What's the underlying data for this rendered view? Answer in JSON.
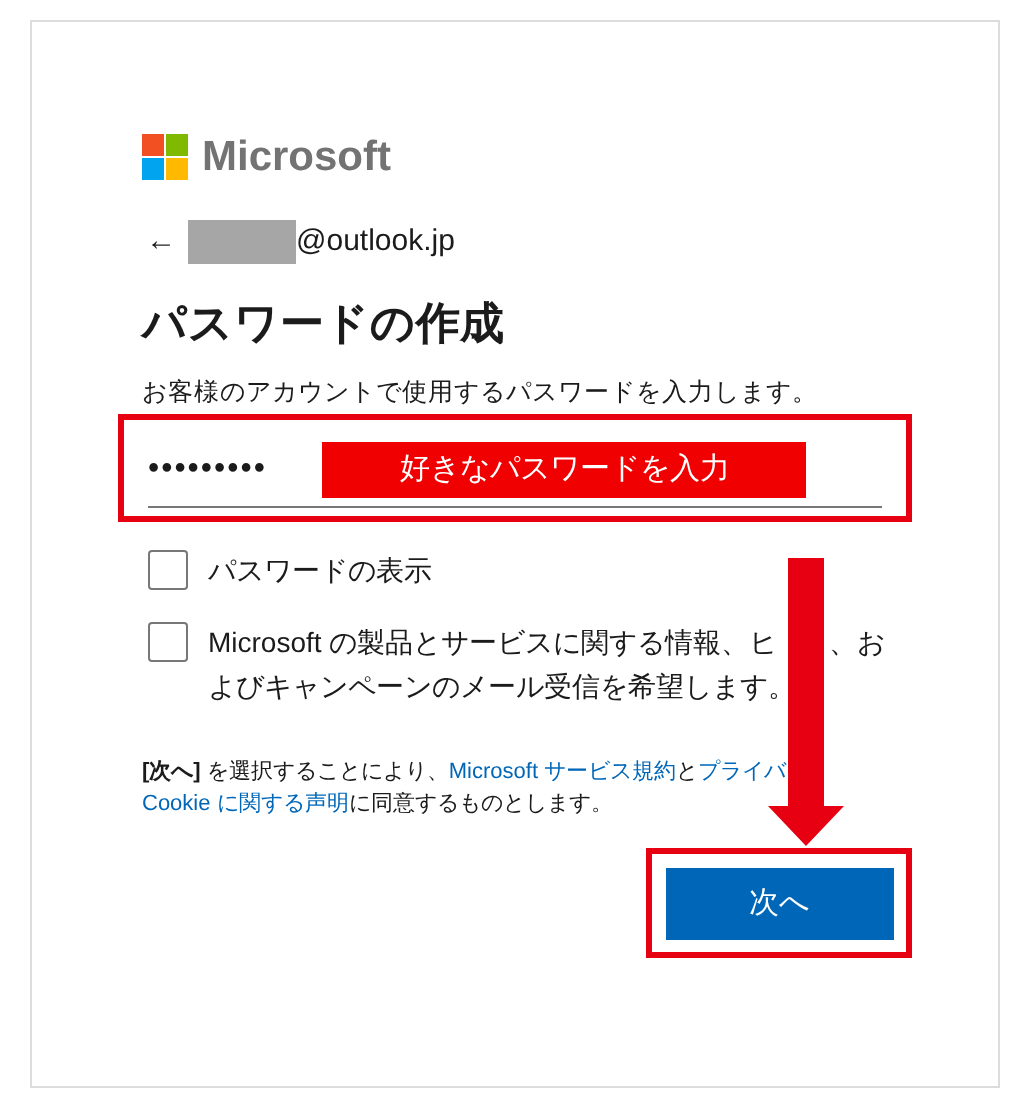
{
  "logo": {
    "name": "Microsoft"
  },
  "account": {
    "back": "←",
    "email": "@outlook.jp",
    "redacted": true
  },
  "title": "パスワードの作成",
  "instruction": "お客様のアカウントで使用するパスワードを入力します。",
  "password": {
    "value": "•••••••••",
    "annotation": "好きなパスワードを入力"
  },
  "checkboxes": [
    {
      "lines": [
        [
          "パスワードの表示"
        ]
      ],
      "checked": false
    },
    {
      "lines": [
        [
          "Microsoft の製品とサービスに関する情報、ヒ",
          "、お"
        ],
        [
          "よびキャンペーンのメール受信を希望します。"
        ]
      ],
      "checked": false
    }
  ],
  "legal": [
    [
      {
        "kind": "bold",
        "text": "[次へ]"
      },
      {
        "kind": "text",
        "text": " を選択することにより、"
      },
      {
        "kind": "link",
        "text": "Microsoft サービス規約"
      },
      {
        "kind": "text",
        "text": "と"
      },
      {
        "kind": "link",
        "text": "プライバ"
      }
    ],
    [
      {
        "kind": "link",
        "text": "Cookie に関する声明"
      },
      {
        "kind": "text",
        "text": "に同意するものとします。"
      }
    ]
  ],
  "button": {
    "label": "次へ"
  }
}
